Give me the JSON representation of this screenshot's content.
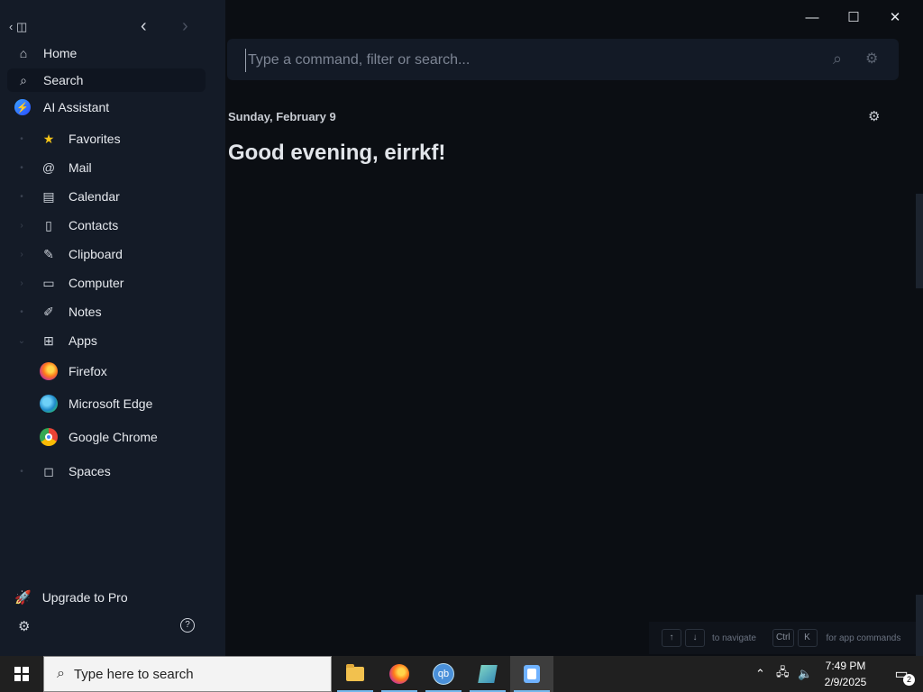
{
  "sidebar": {
    "toggle_icon": "‹ ◫",
    "back_icon": "‹",
    "forward_icon": "›",
    "top_items": [
      {
        "label": "Home",
        "icon": "⌂"
      },
      {
        "label": "Search",
        "icon": "⌕"
      },
      {
        "label": "AI Assistant",
        "icon": "⚡"
      }
    ],
    "sections": [
      {
        "label": "Favorites",
        "icon": "★",
        "expander": "•"
      },
      {
        "label": "Mail",
        "icon": "@",
        "expander": "•"
      },
      {
        "label": "Calendar",
        "icon": "▤",
        "expander": "•"
      },
      {
        "label": "Contacts",
        "icon": "▯",
        "expander": "›"
      },
      {
        "label": "Clipboard",
        "icon": "✎",
        "expander": "›"
      },
      {
        "label": "Computer",
        "icon": "▭",
        "expander": "›"
      },
      {
        "label": "Notes",
        "icon": "✐",
        "expander": "•"
      },
      {
        "label": "Apps",
        "icon": "⊞",
        "expander": "⌄"
      }
    ],
    "apps": [
      {
        "label": "Firefox"
      },
      {
        "label": "Microsoft Edge"
      },
      {
        "label": "Google Chrome"
      }
    ],
    "spaces": {
      "label": "Spaces",
      "icon": "◻",
      "expander": "•"
    },
    "upgrade": {
      "label": "Upgrade to Pro",
      "icon": "🚀"
    },
    "settings_icon": "⚙",
    "help_icon": "?"
  },
  "window": {
    "minimize": "—",
    "maximize": "☐",
    "close": "✕"
  },
  "search": {
    "placeholder": "Type a command, filter or search...",
    "search_icon": "⌕",
    "filter_icon": "⚙"
  },
  "main": {
    "date": "Sunday, February 9",
    "greeting": "Good evening, eirrkf!",
    "settings_icon": "⚙"
  },
  "hints": {
    "up": "↑",
    "down": "↓",
    "navigate": "to navigate",
    "ctrl": "Ctrl",
    "k": "K",
    "app_commands": "for app commands"
  },
  "taskbar": {
    "search_placeholder": "Type here to search",
    "search_icon": "⌕",
    "qb_label": "qb",
    "time": "7:49 PM",
    "date": "2/9/2025",
    "tray_chevron": "⌃",
    "network_icon": "🖧",
    "volume_icon": "🔈",
    "notification_icon": "▭",
    "notification_count": "2"
  }
}
